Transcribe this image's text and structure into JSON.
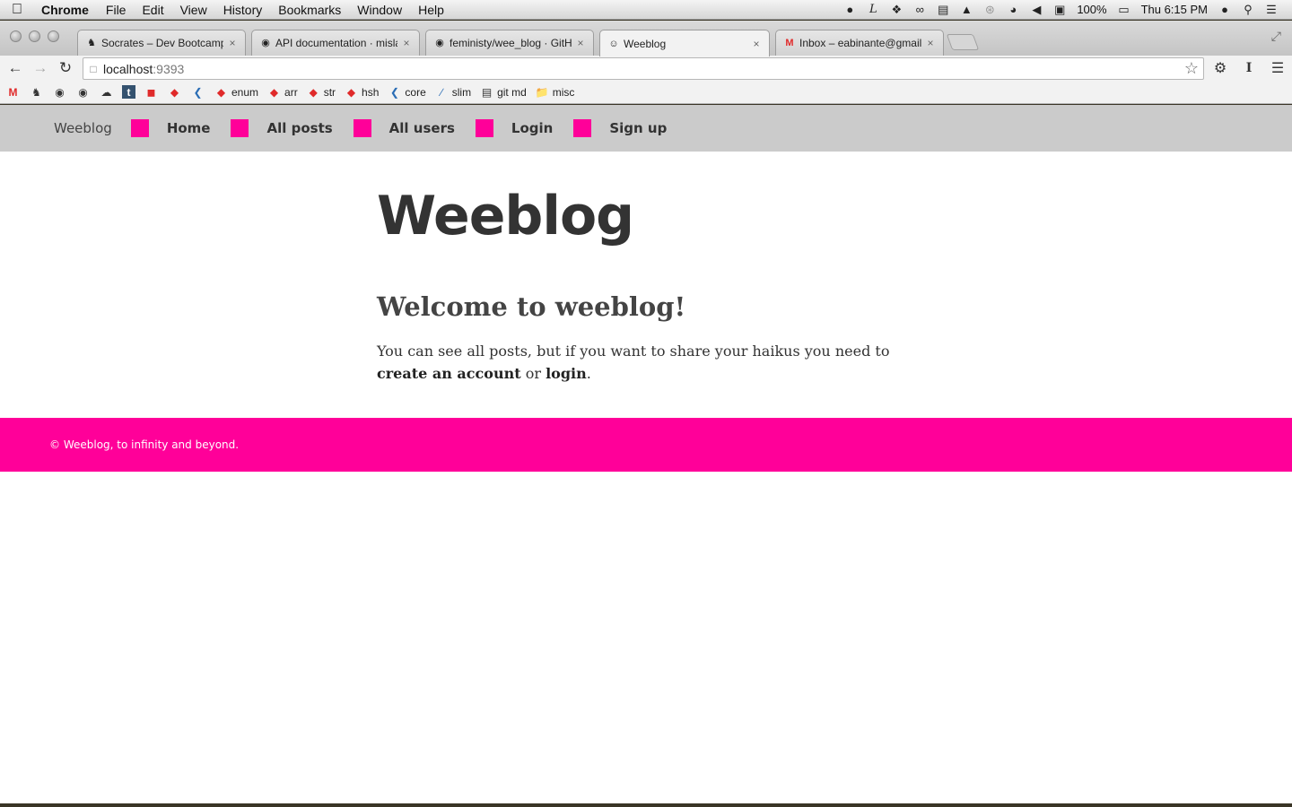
{
  "menubar": {
    "app_name": "Chrome",
    "menus": [
      "File",
      "Edit",
      "View",
      "History",
      "Bookmarks",
      "Window",
      "Help"
    ],
    "battery": "100%",
    "clock": "Thu 6:15 PM"
  },
  "tabs": [
    {
      "title": "Socrates – Dev Bootcamp",
      "icon": "socrates-icon"
    },
    {
      "title": "API documentation · misla",
      "icon": "github-icon"
    },
    {
      "title": "feministy/wee_blog · GitHu",
      "icon": "github-icon"
    },
    {
      "title": "Weeblog",
      "icon": "weeblog-icon",
      "active": true
    },
    {
      "title": "Inbox – eabinante@gmail.c",
      "icon": "gmail-icon"
    }
  ],
  "address_bar": {
    "host": "localhost",
    "port": ":9393"
  },
  "bookmarks": [
    {
      "label": "",
      "icon": "gmail-icon"
    },
    {
      "label": "",
      "icon": "socrates-icon"
    },
    {
      "label": "",
      "icon": "circle-icon"
    },
    {
      "label": "",
      "icon": "github-icon"
    },
    {
      "label": "",
      "icon": "cloud-icon"
    },
    {
      "label": "",
      "icon": "tumblr-icon"
    },
    {
      "label": "",
      "icon": "rubyforge-icon"
    },
    {
      "label": "",
      "icon": "ruby-icon"
    },
    {
      "label": "",
      "icon": "sinatra-icon"
    },
    {
      "label": "enum",
      "icon": "ruby-icon"
    },
    {
      "label": "arr",
      "icon": "ruby-icon"
    },
    {
      "label": "str",
      "icon": "ruby-icon"
    },
    {
      "label": "hsh",
      "icon": "ruby-icon"
    },
    {
      "label": "core",
      "icon": "sinatra-icon"
    },
    {
      "label": "slim",
      "icon": "slim-icon"
    },
    {
      "label": "git md",
      "icon": "page-icon"
    },
    {
      "label": "misc",
      "icon": "folder-icon"
    }
  ],
  "site": {
    "brand": "Weeblog",
    "nav": [
      "Home",
      "All posts",
      "All users",
      "Login",
      "Sign up"
    ],
    "title": "Weeblog",
    "welcome": "Welcome to weeblog!",
    "intro_before": "You can see all posts, but if you want to share your haikus you need to ",
    "intro_link1": "create an account",
    "intro_middle": " or ",
    "intro_link2": "login",
    "intro_after": ".",
    "footer": "© Weeblog, to infinity and beyond."
  },
  "colors": {
    "accent": "#ff0099",
    "nav_bg": "#cbcbcb"
  }
}
